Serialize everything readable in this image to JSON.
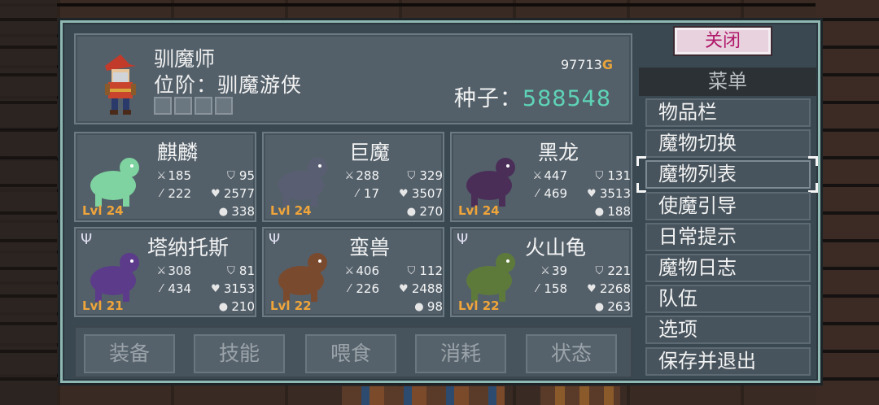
{
  "hero": {
    "name": "驯魔师",
    "rank": "位阶：驯魔游侠",
    "gold": "97713",
    "gold_suffix": "G",
    "seeds_label": "种子：",
    "seeds_value": "588548"
  },
  "monsters": [
    {
      "name": "麒麟",
      "atk": "185",
      "def": "95",
      "mag": "222",
      "hp": "2577",
      "extra": "338",
      "level": "Lvl 24",
      "fork": false,
      "sprite_color": "#7fd3a0"
    },
    {
      "name": "巨魔",
      "atk": "288",
      "def": "329",
      "mag": "17",
      "hp": "3507",
      "extra": "270",
      "level": "Lvl 24",
      "fork": false,
      "sprite_color": "#5a5e72"
    },
    {
      "name": "黑龙",
      "atk": "447",
      "def": "131",
      "mag": "469",
      "hp": "3513",
      "extra": "188",
      "level": "Lvl 24",
      "fork": false,
      "sprite_color": "#4a2e58"
    },
    {
      "name": "塔纳托斯",
      "atk": "308",
      "def": "81",
      "mag": "434",
      "hp": "3153",
      "extra": "210",
      "level": "Lvl 21",
      "fork": true,
      "sprite_color": "#5b3b8a"
    },
    {
      "name": "蛮兽",
      "atk": "406",
      "def": "112",
      "mag": "226",
      "hp": "2488",
      "extra": "98",
      "level": "Lvl 22",
      "fork": true,
      "sprite_color": "#7a4a2e"
    },
    {
      "name": "火山龟",
      "atk": "39",
      "def": "221",
      "mag": "158",
      "hp": "2268",
      "extra": "263",
      "level": "Lvl 22",
      "fork": true,
      "sprite_color": "#5e7a3a"
    }
  ],
  "fork_glyph": "Ψ",
  "actions": [
    "装备",
    "技能",
    "喂食",
    "消耗",
    "状态"
  ],
  "menu": {
    "close_label": "关闭",
    "title": "菜单",
    "items": [
      "物品栏",
      "魔物切换",
      "魔物列表",
      "使魔引导",
      "日常提示",
      "魔物日志",
      "队伍",
      "选项",
      "保存并退出"
    ],
    "selected_index": 2
  },
  "colors": {
    "level": "#f0a53a",
    "seeds": "#5fd3b6",
    "gold_mark": "#e8a33a",
    "close_text": "#b0176a"
  }
}
